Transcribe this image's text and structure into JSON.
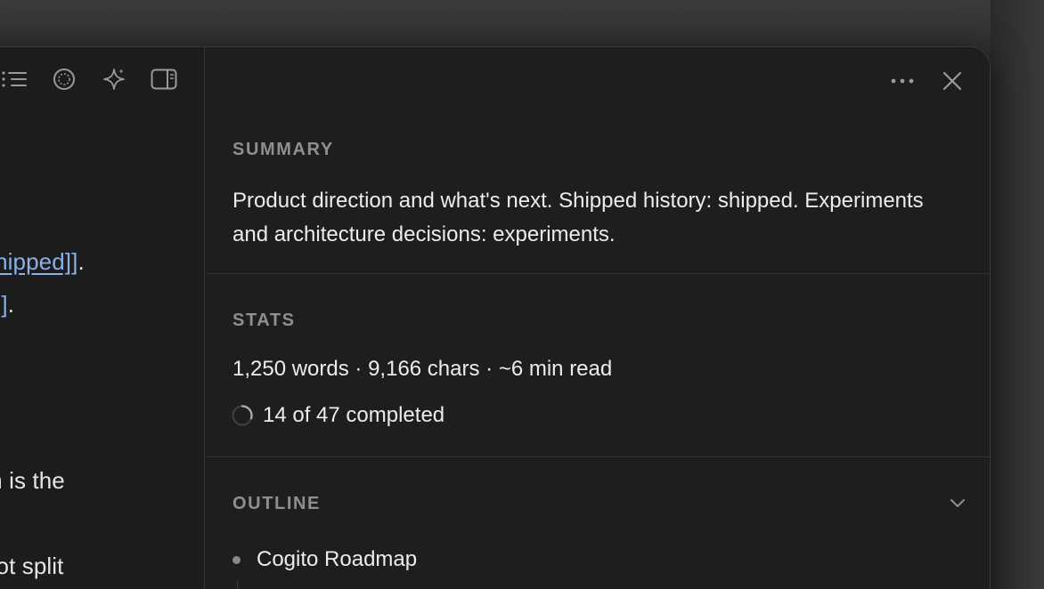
{
  "editor": {
    "toolbar": {
      "icons": [
        "list-icon",
        "target-icon",
        "sparkle-icon",
        "sidebar-toggle-icon"
      ]
    },
    "lines": [
      {
        "prefix": "",
        "link": "shipped]]",
        "suffix": "."
      },
      {
        "prefix": "",
        "link": "s]]",
        "suffix": "."
      },
      {
        "text": "m is the"
      },
      {
        "text": " not split"
      }
    ]
  },
  "panel": {
    "top_icons": [
      "more-icon",
      "close-icon"
    ],
    "summary": {
      "title": "SUMMARY",
      "text": "Product direction and what's next. Shipped history: shipped. Experiments and architecture decisions: experiments."
    },
    "stats": {
      "title": "STATS",
      "line": "1,250 words · 9,166 chars · ~6 min read",
      "progress_text": "14 of 47 completed",
      "completed": 14,
      "total": 47
    },
    "outline": {
      "title": "OUTLINE",
      "items": [
        {
          "label": "Cogito Roadmap"
        }
      ]
    }
  },
  "colors": {
    "background": "#1e1e1f",
    "link": "#8ab0e6",
    "muted_heading": "#8f8f93",
    "text": "#ececec"
  }
}
